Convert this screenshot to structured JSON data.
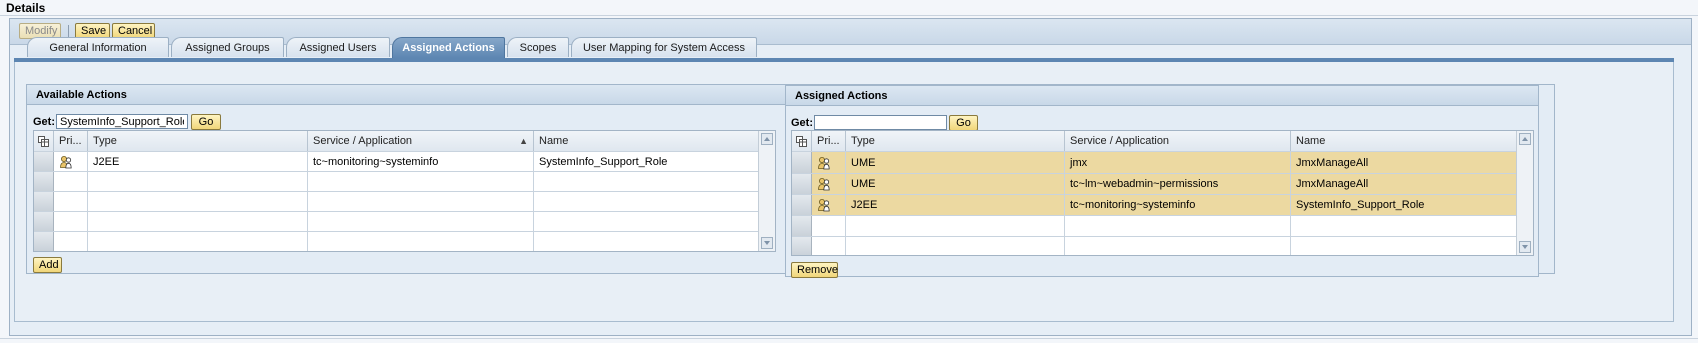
{
  "page": {
    "title": "Details"
  },
  "toolbar": {
    "modify_label": "Modify",
    "save_label": "Save",
    "cancel_label": "Cancel"
  },
  "tabs": [
    {
      "label": "General Information",
      "active": false
    },
    {
      "label": "Assigned Groups",
      "active": false
    },
    {
      "label": "Assigned Users",
      "active": false
    },
    {
      "label": "Assigned Actions",
      "active": true
    },
    {
      "label": "Scopes",
      "active": false
    },
    {
      "label": "User Mapping for System Access",
      "active": false
    }
  ],
  "available": {
    "title": "Available Actions",
    "get_label": "Get:",
    "search_value": "SystemInfo_Support_Role",
    "go_label": "Go",
    "columns": {
      "principal": "Pri...",
      "type": "Type",
      "service": "Service / Application",
      "name": "Name"
    },
    "sort_indicator": "▲",
    "rows": [
      {
        "type": "J2EE",
        "service": "tc~monitoring~systeminfo",
        "name": "SystemInfo_Support_Role"
      }
    ],
    "add_label": "Add"
  },
  "assigned": {
    "title": "Assigned Actions",
    "get_label": "Get:",
    "search_value": "",
    "go_label": "Go",
    "columns": {
      "principal": "Pri...",
      "type": "Type",
      "service": "Service / Application",
      "name": "Name"
    },
    "rows": [
      {
        "type": "UME",
        "service": "jmx",
        "name": "JmxManageAll"
      },
      {
        "type": "UME",
        "service": "tc~lm~webadmin~permissions",
        "name": "JmxManageAll"
      },
      {
        "type": "J2EE",
        "service": "tc~monitoring~systeminfo",
        "name": "SystemInfo_Support_Role"
      }
    ],
    "remove_label": "Remove"
  },
  "colors": {
    "tab_active": "#5d86b2",
    "row_highlight": "#ecd9a1",
    "button": "#f1d67a"
  },
  "icons": {
    "column_settings": "table-settings-icon",
    "principal": "role-principal-icon"
  }
}
